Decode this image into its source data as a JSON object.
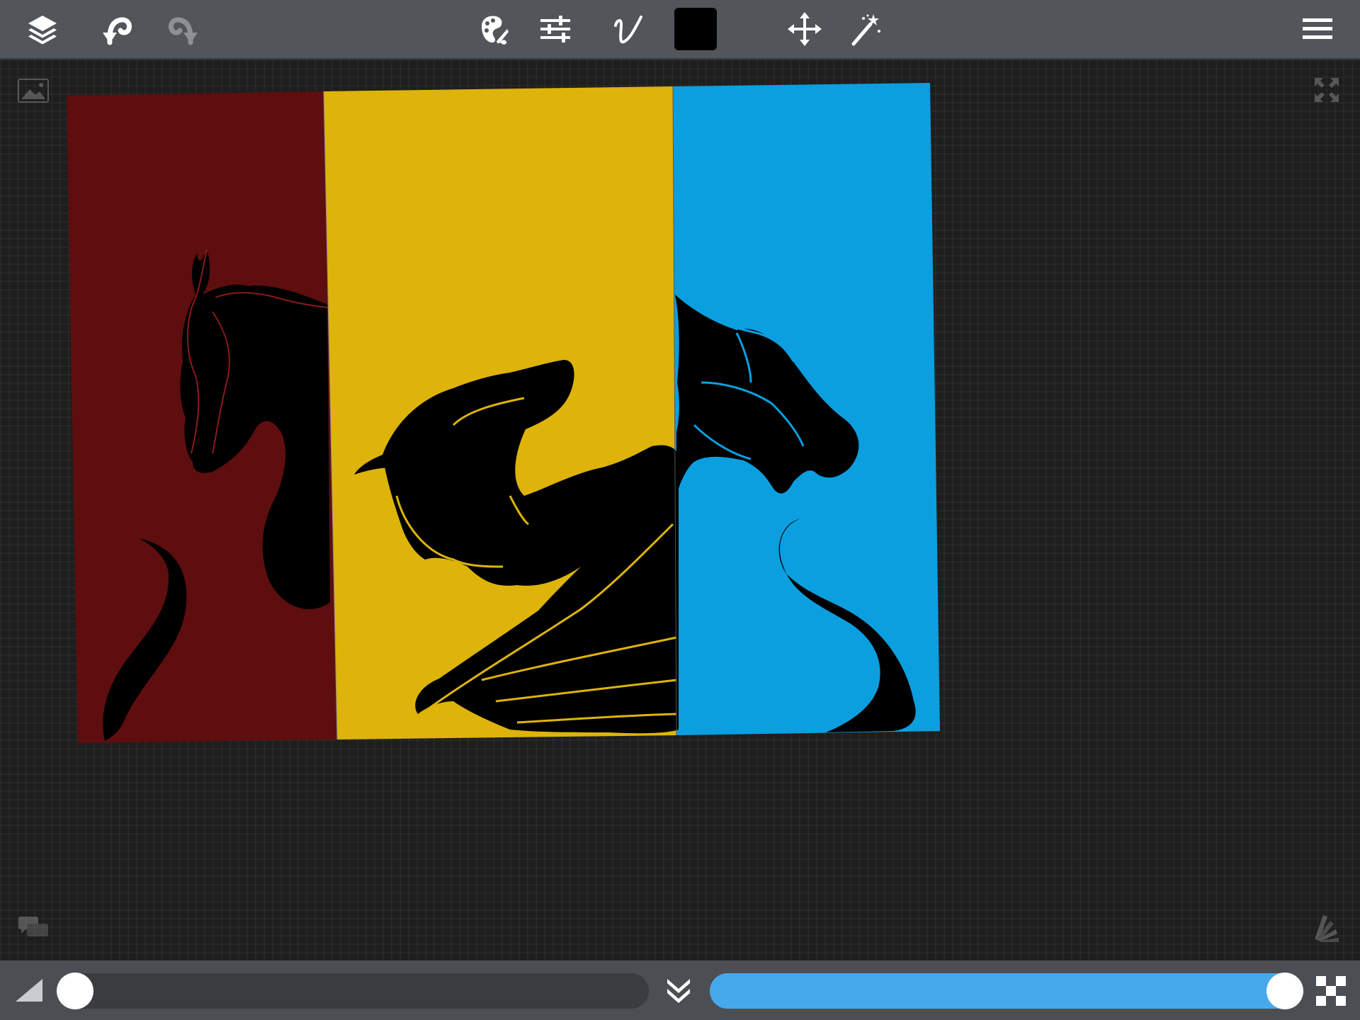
{
  "toolbar": {
    "brush_color": "#000000",
    "icons": [
      "layers-icon",
      "undo-icon",
      "redo-icon",
      "brush-library-icon",
      "adjustments-icon",
      "stroke-icon",
      "move-icon",
      "magic-wand-icon",
      "menu-icon"
    ]
  },
  "canvas": {
    "panel_colors": {
      "left": "#5e0e0e",
      "middle": "#deb40a",
      "right": "#0b9fe0"
    },
    "background": "#1e1e1e"
  },
  "bottom_bar": {
    "brush_size_value": 0.0,
    "opacity_value": 1.0,
    "size_track_color": "#3a3c3f",
    "opacity_track_color": "#46a9ec"
  }
}
